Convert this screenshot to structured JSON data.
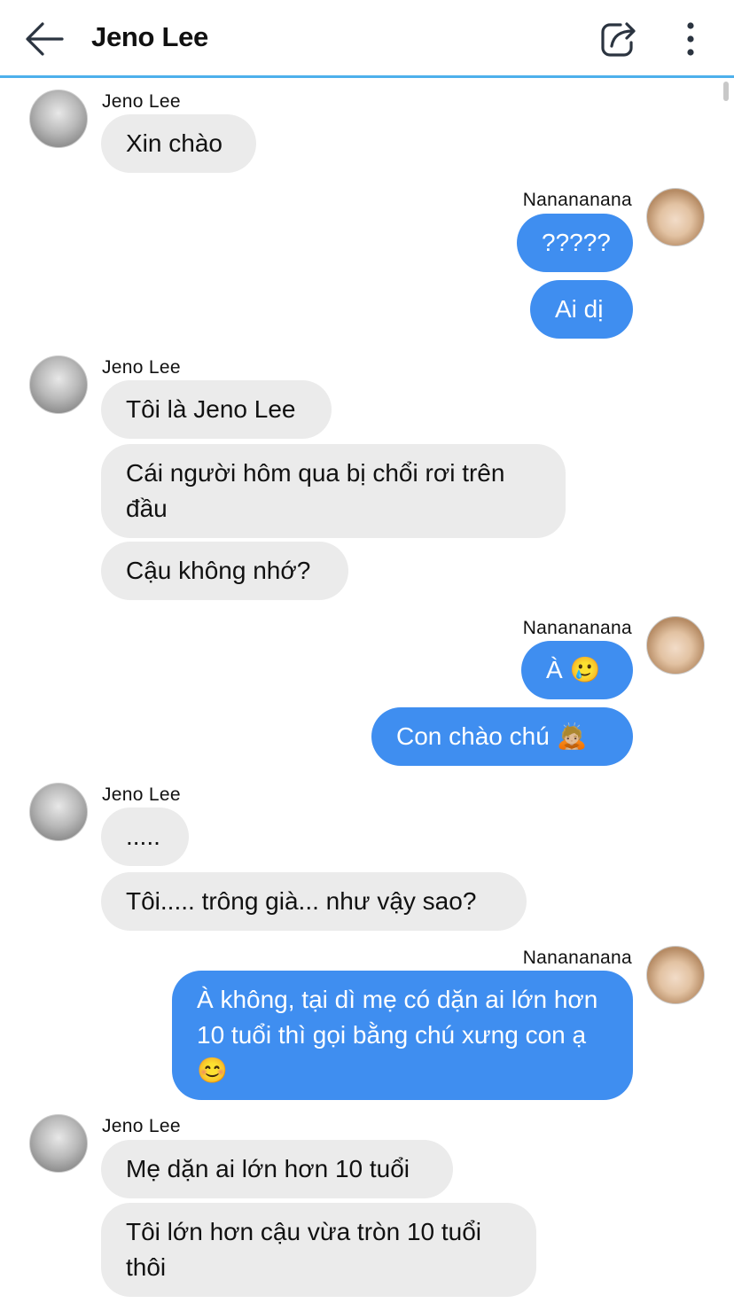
{
  "header": {
    "title": "Jeno Lee"
  },
  "icons": {
    "back": "back-arrow-icon",
    "share": "share-icon",
    "more": "more-vertical-icon"
  },
  "senders": {
    "them": "Jeno Lee",
    "me": "Nanananana"
  },
  "messages": [
    {
      "from": "them",
      "text": "Xin chào"
    },
    {
      "from": "me",
      "text": "?????"
    },
    {
      "from": "me",
      "text": "Ai dị"
    },
    {
      "from": "them",
      "text": "Tôi là Jeno Lee"
    },
    {
      "from": "them",
      "text": "Cái người hôm qua bị chổi rơi trên đầu"
    },
    {
      "from": "them",
      "text": "Cậu không nhớ?"
    },
    {
      "from": "me",
      "text": "À 🥲"
    },
    {
      "from": "me",
      "text": "Con chào chú 🙇🏼"
    },
    {
      "from": "them",
      "text": "....."
    },
    {
      "from": "them",
      "text": "Tôi..... trông già... như vậy sao?"
    },
    {
      "from": "me",
      "text": "À không, tại dì mẹ có dặn ai lớn hơn 10 tuổi thì gọi bằng chú xưng con ạ 😊"
    },
    {
      "from": "them",
      "text": "Mẹ dặn ai lớn hơn 10 tuổi"
    },
    {
      "from": "them",
      "text": "Tôi lớn hơn cậu vừa tròn 10 tuổi thôi"
    }
  ]
}
